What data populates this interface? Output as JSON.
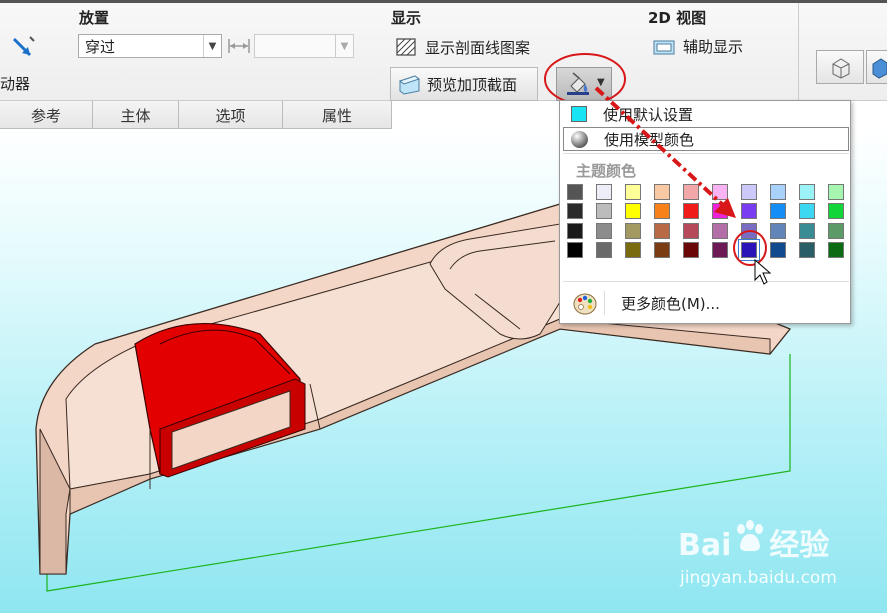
{
  "ribbon": {
    "placement_title": "放置",
    "display_title": "显示",
    "view2d_title": "2D 视图",
    "left_label": "动器",
    "placement_value": "穿过",
    "hatch_label": "显示剖面线图案",
    "preview_label": "预览加顶截面",
    "aux_label": "辅助显示"
  },
  "tabs": [
    "参考",
    "主体",
    "选项",
    "属性"
  ],
  "menu": {
    "default_label": "使用默认设置",
    "model_color_label": "使用模型颜色",
    "theme_title": "主题颜色",
    "more_colors_label": "更多颜色(M)...",
    "palette": [
      [
        "#555555",
        "#eeeef9",
        "#ffff99",
        "#f9c9a4",
        "#f2a8a8",
        "#f9b3f2",
        "#cdc8fb",
        "#a8d2fb",
        "#9cf3f7",
        "#a8f5b0"
      ],
      [
        "#2a2a2a",
        "#bcbcbc",
        "#ffff00",
        "#f7821a",
        "#ef1b1b",
        "#ec24d8",
        "#7a3cf1",
        "#148ef6",
        "#3cd8f2",
        "#12d53a"
      ],
      [
        "#1a1a1a",
        "#8c8c8c",
        "#a39a62",
        "#b86a46",
        "#b64a5a",
        "#b36ea8",
        "#7a6cc3",
        "#6285b8",
        "#3a8c94",
        "#5c9a68"
      ],
      [
        "#000000",
        "#6a6a6a",
        "#7b6b10",
        "#7a3c12",
        "#6a0707",
        "#6b1a55",
        "#2a14b8",
        "#114a8f",
        "#2a5e66",
        "#0a6b12"
      ]
    ],
    "selected_swatch": "#2a14b8"
  },
  "watermark": {
    "brand_left": "Bai",
    "brand_right": "经验",
    "url": "jingyan.baidu.com"
  },
  "colors": {
    "part_body": "#f3d6c6",
    "part_edge": "#3a2a22",
    "section_red": "#e30000",
    "bbox_green": "#1db41d",
    "annotation_red": "#d81818"
  }
}
